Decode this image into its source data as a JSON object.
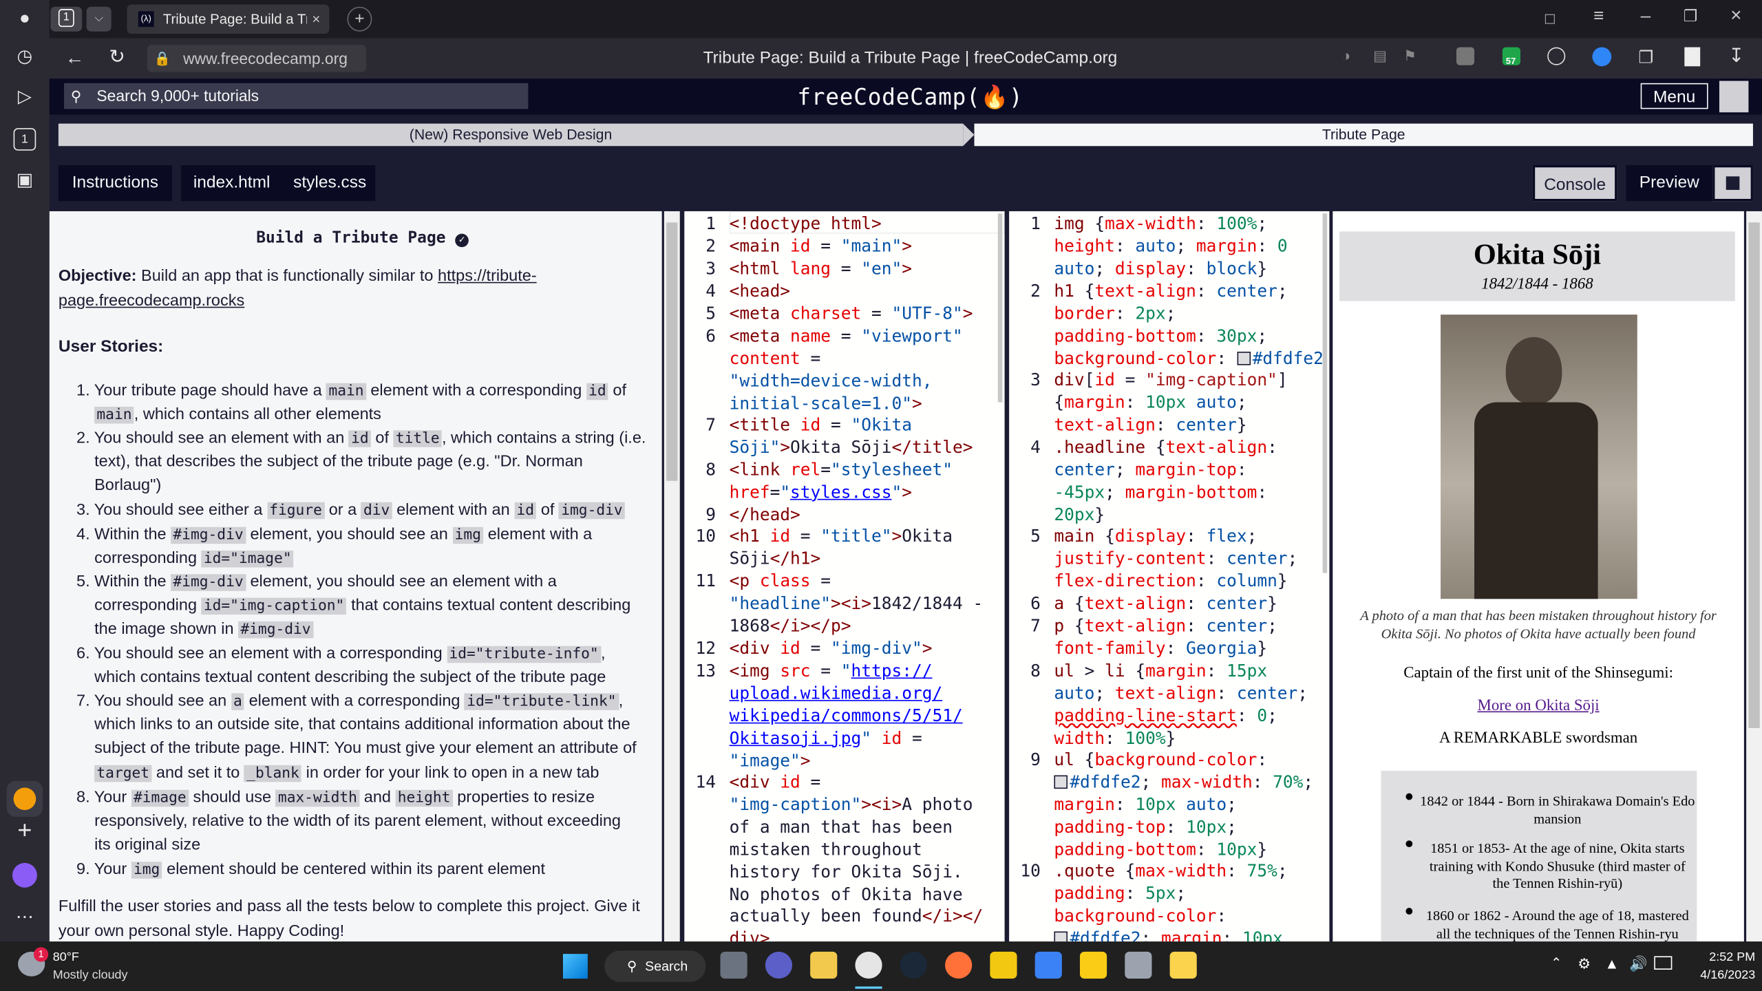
{
  "browser": {
    "tab_count": "1",
    "tab_title": "Tribute Page: Build a Tribute Page | freeCodeCamp.org",
    "url": "www.freecodecamp.org",
    "page_title": "Tribute Page: Build a Tribute Page | freeCodeCamp.org",
    "extension_badge": "57"
  },
  "fcc": {
    "search_placeholder": "Search 9,000+ tutorials",
    "logo": "freeCodeCamp(🔥)",
    "menu_label": "Menu",
    "breadcrumb": [
      "(New) Responsive Web Design",
      "Tribute Page"
    ],
    "tabs": {
      "instructions": "Instructions",
      "index": "index.html",
      "styles": "styles.css",
      "console": "Console",
      "preview": "Preview"
    }
  },
  "instructions": {
    "heading": "Build a Tribute Page",
    "objective_label": "Objective:",
    "objective_text": " Build an app that is functionally similar to ",
    "objective_link": "https://tribute-page.freecodecamp.rocks",
    "user_stories_label": "User Stories:",
    "footer": "Fulfill the user stories and pass all the tests below to complete this project. Give it your own personal style. Happy Coding!"
  },
  "preview": {
    "title": "Okita Sōji",
    "dates": "1842/1844 - 1868",
    "caption": "A photo of a man that has been mistaken throughout history for Okita Sōji. No photos of Okita have actually been found",
    "captain": "Captain of the first unit of the Shinsegumi:",
    "link": "More on Okita Sōji",
    "remarkable": "A REMARKABLE swordsman",
    "timeline": [
      "1842 or 1844 - Born in Shirakawa Domain's Edo mansion",
      "1851 or 1853- At the age of nine, Okita starts training with Kondo Shusuke (third master of the Tennen Rishin-ryū)",
      "1860 or 1862 - Around the age of 18, mastered all the techniques of the Tennen Rishin-ryu"
    ]
  },
  "taskbar": {
    "weather_temp": "80°F",
    "weather_desc": "Mostly cloudy",
    "weather_badge": "1",
    "search_label": "Search",
    "time": "2:52 PM",
    "date": "4/16/2023"
  },
  "colors": {
    "fcc_dark": "#0a0a23",
    "fcc_panel": "#1b1b32",
    "fcc_light": "#f5f6f7",
    "fcc_gray": "#d0d0d5",
    "preview_bg": "#dfdfe2"
  },
  "icons": [
    "profile-icon",
    "history-icon",
    "play-icon",
    "workspaces-icon",
    "screenshot-icon",
    "refresh-icon",
    "back-icon",
    "lock-icon",
    "bookmark-icon",
    "download-icon",
    "search-icon",
    "menu-icon",
    "plus-icon",
    "settings-icon",
    "verified-check-icon",
    "windows-start-icon"
  ]
}
